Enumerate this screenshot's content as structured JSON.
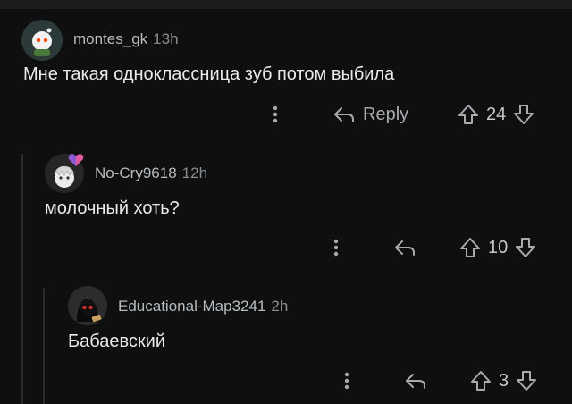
{
  "comments": [
    {
      "username": "montes_gk",
      "time": "13h",
      "text": "Мне такая одноклассница зуб потом выбила",
      "reply_label": "Reply",
      "votes": "24"
    },
    {
      "username": "No-Cry9618",
      "time": "12h",
      "text": "молочный хоть?",
      "reply_label": "",
      "votes": "10"
    },
    {
      "username": "Educational-Map3241",
      "time": "2h",
      "text": "Бабаевский",
      "reply_label": "",
      "votes": "3"
    }
  ],
  "colors": {
    "background": "#0f0f0f",
    "thread_line": "#2b2b2b",
    "text": "#e8eaeb",
    "muted": "#8a8d90"
  },
  "icons": [
    "more-icon",
    "reply-icon",
    "upvote-icon",
    "downvote-icon"
  ]
}
